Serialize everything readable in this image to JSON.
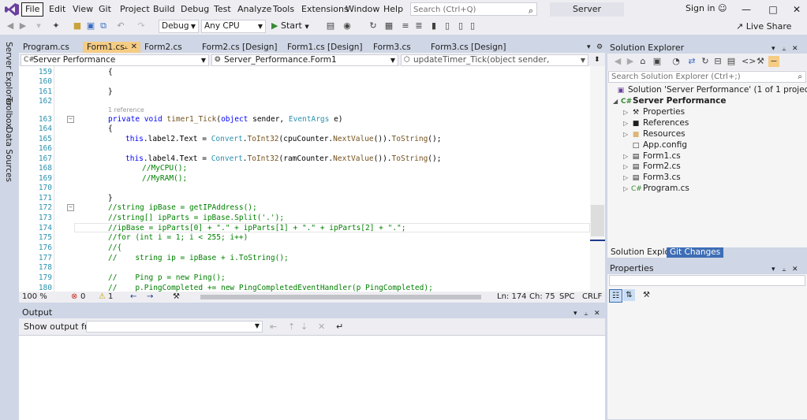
{
  "menu": {
    "logo": "visual-studio-logo-icon",
    "items": [
      "File",
      "Edit",
      "View",
      "Git",
      "Project",
      "Build",
      "Debug",
      "Test",
      "Analyze",
      "Tools",
      "Extensions",
      "Window",
      "Help"
    ],
    "search_placeholder": "Search (Ctrl+Q)",
    "solution_name": "Server Performance",
    "sign_in": "Sign in"
  },
  "toolbar": {
    "config": "Debug",
    "platform": "Any CPU",
    "start": "Start",
    "live_share": "Live Share"
  },
  "left_strip": [
    "Server Explorer",
    "Toolbox",
    "Data Sources"
  ],
  "tabs": [
    {
      "label": "Program.cs",
      "active": false
    },
    {
      "label": "Form1.cs",
      "active": true
    },
    {
      "label": "Form2.cs",
      "active": false
    },
    {
      "label": "Form2.cs [Design]",
      "active": false
    },
    {
      "label": "Form1.cs [Design]",
      "active": false
    },
    {
      "label": "Form3.cs",
      "active": false
    },
    {
      "label": "Form3.cs [Design]",
      "active": false
    }
  ],
  "navbar": {
    "project": "Server Performance",
    "class": "Server_Performance.Form1",
    "member": "updateTimer_Tick(object sender, EventArgs e)"
  },
  "editor": {
    "codelens": "1 reference",
    "lines": [
      {
        "n": "159",
        "code": "{"
      },
      {
        "n": "160",
        "code": ""
      },
      {
        "n": "161",
        "code": "}"
      },
      {
        "n": "162",
        "code": ""
      },
      {
        "n": "163",
        "code": "private void timer1_Tick(object sender, EventArgs e)"
      },
      {
        "n": "164",
        "code": "{"
      },
      {
        "n": "165",
        "code": "this.label2.Text = Convert.ToInt32(cpuCounter.NextValue()).ToString();"
      },
      {
        "n": "166",
        "code": ""
      },
      {
        "n": "167",
        "code": "this.label4.Text = Convert.ToInt32(ramCounter.NextValue()).ToString();"
      },
      {
        "n": "168",
        "code": "//MyCPU();"
      },
      {
        "n": "169",
        "code": "//MyRAM();"
      },
      {
        "n": "170",
        "code": ""
      },
      {
        "n": "171",
        "code": "}"
      },
      {
        "n": "172",
        "code": "//string ipBase = getIPAddress();"
      },
      {
        "n": "173",
        "code": "//string[] ipParts = ipBase.Split('.');"
      },
      {
        "n": "174",
        "code": "//ipBase = ipParts[0] + \".\" + ipParts[1] + \".\" + ipParts[2] + \".\";"
      },
      {
        "n": "175",
        "code": "//for (int i = 1; i < 255; i++)"
      },
      {
        "n": "176",
        "code": "//{"
      },
      {
        "n": "177",
        "code": "//    string ip = ipBase + i.ToString();"
      },
      {
        "n": "178",
        "code": ""
      },
      {
        "n": "179",
        "code": "//    Ping p = new Ping();"
      },
      {
        "n": "180",
        "code": "//    p.PingCompleted += new PingCompletedEventHandler(p_PingCompleted);"
      }
    ]
  },
  "editor_status": {
    "zoom": "100 %",
    "errors": "0",
    "warnings": "1",
    "ln": "Ln: 174",
    "ch": "Ch: 75",
    "spc": "SPC",
    "crlf": "CRLF"
  },
  "output": {
    "title": "Output",
    "show_from_label": "Show output from:"
  },
  "solution_explorer": {
    "title": "Solution Explorer",
    "search_placeholder": "Search Solution Explorer (Ctrl+;)",
    "solution": "Solution 'Server Performance' (1 of 1 project)",
    "project": "Server Performance",
    "items": [
      "Properties",
      "References",
      "Resources",
      "App.config",
      "Form1.cs",
      "Form2.cs",
      "Form3.cs",
      "Program.cs"
    ],
    "bottom_tabs": [
      "Solution Explorer",
      "Git Changes"
    ]
  },
  "properties": {
    "title": "Properties"
  }
}
